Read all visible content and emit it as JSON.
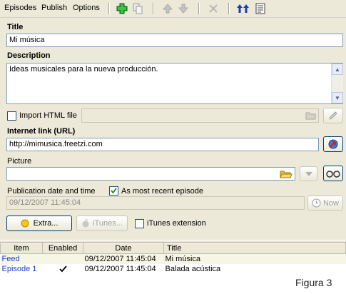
{
  "menu": {
    "episodes": "Episodes",
    "publish": "Publish",
    "options": "Options"
  },
  "toolbar": {
    "icons": [
      "add-icon",
      "copy-icon",
      "move-up-icon",
      "move-down-icon",
      "delete-icon",
      "sort-icon",
      "notes-icon"
    ]
  },
  "form": {
    "title_label": "Title",
    "title_value": "Mi música",
    "description_label": "Description",
    "description_value": "Ideas musicales para la nueva producción.",
    "import_html_label": "Import HTML file",
    "internet_link_label": "Internet link (URL)",
    "internet_link_value": "http://mimusica.freetzi.com",
    "picture_label": "Picture",
    "picture_value": "",
    "pubdate_label": "Publication date and time",
    "most_recent_label": "As most recent episode",
    "pubdate_value": "09/12/2007 11:45:04",
    "now_label": "Now",
    "extra_label": "Extra...",
    "itunes_label": "iTunes...",
    "itunes_ext_label": "iTunes extension"
  },
  "table": {
    "headers": [
      "Item",
      "Enabled",
      "Date",
      "Title"
    ],
    "rows": [
      {
        "item": "Feed",
        "enabled": false,
        "date": "09/12/2007 11:45:04",
        "title": "Mi música"
      },
      {
        "item": "Episode 1",
        "enabled": true,
        "date": "09/12/2007 11:45:04",
        "title": "Balada acústica"
      }
    ]
  },
  "caption": "Figura 3"
}
